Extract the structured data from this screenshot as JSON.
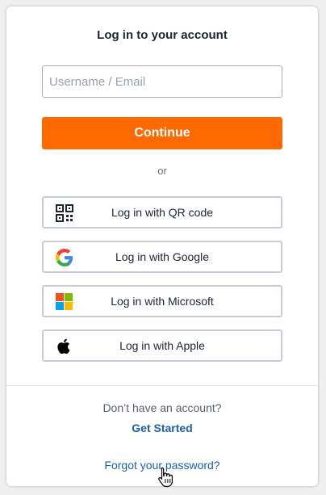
{
  "login": {
    "title": "Log in to your account",
    "username_placeholder": "Username / Email",
    "username_value": "",
    "continue_label": "Continue",
    "or_label": "or",
    "sso_buttons": [
      {
        "label": "Log in with QR code",
        "icon": "qr-code-icon"
      },
      {
        "label": "Log in with Google",
        "icon": "google-icon"
      },
      {
        "label": "Log in with Microsoft",
        "icon": "microsoft-icon"
      },
      {
        "label": "Log in with Apple",
        "icon": "apple-icon"
      }
    ],
    "signup_prompt": "Don’t have an account?",
    "get_started_label": "Get Started",
    "forgot_label": "Forgot your password?"
  },
  "colors": {
    "accent": "#ff6a00",
    "link": "#1a5fb4",
    "border": "#c9ced6"
  },
  "cursor": {
    "icon": "hand-pointer-icon"
  }
}
